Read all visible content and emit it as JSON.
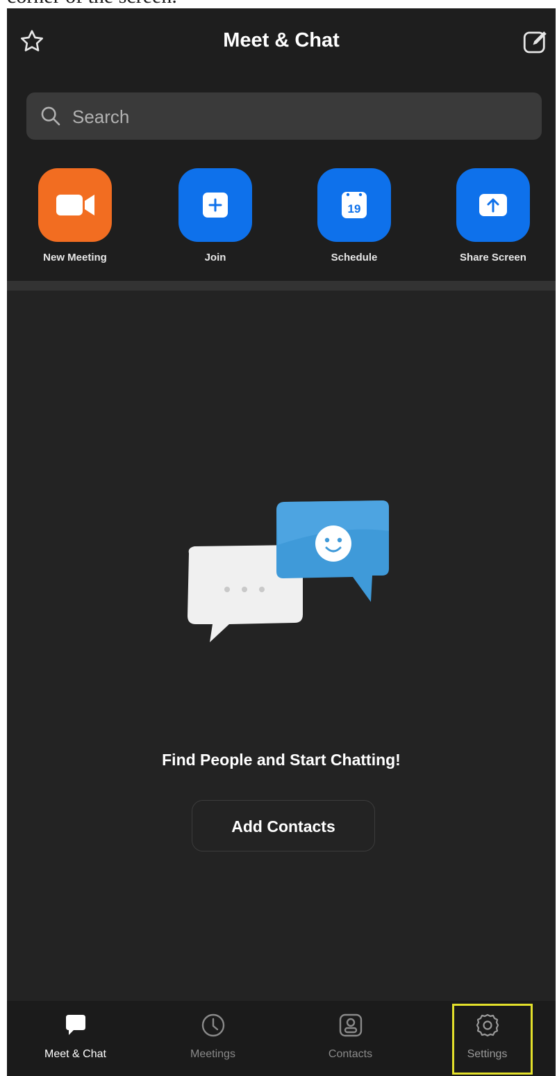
{
  "caption": "corner of the screen.",
  "header": {
    "title": "Meet & Chat",
    "left_icon": "star-icon",
    "right_icon": "compose-icon"
  },
  "search": {
    "placeholder": "Search"
  },
  "actions": [
    {
      "label": "New Meeting",
      "icon": "video-camera-icon",
      "color": "#F26D21"
    },
    {
      "label": "Join",
      "icon": "plus-icon",
      "color": "#0E71EB"
    },
    {
      "label": "Schedule",
      "icon": "calendar-icon",
      "color": "#0E71EB",
      "calendar_day": "19"
    },
    {
      "label": "Share Screen",
      "icon": "share-up-arrow-icon",
      "color": "#0E71EB"
    }
  ],
  "empty_state": {
    "message": "Find People and Start Chatting!",
    "button_label": "Add Contacts"
  },
  "nav": {
    "active": "Meet & Chat",
    "items": [
      {
        "label": "Meet & Chat",
        "icon": "chat-bubble-icon"
      },
      {
        "label": "Meetings",
        "icon": "clock-icon"
      },
      {
        "label": "Contacts",
        "icon": "contact-card-icon"
      },
      {
        "label": "Settings",
        "icon": "gear-icon"
      }
    ]
  },
  "colors": {
    "background": "#232323",
    "header": "#1E1E1E",
    "accent_orange": "#F26D21",
    "accent_blue": "#0E71EB",
    "highlight_box": "#E3E02B"
  }
}
